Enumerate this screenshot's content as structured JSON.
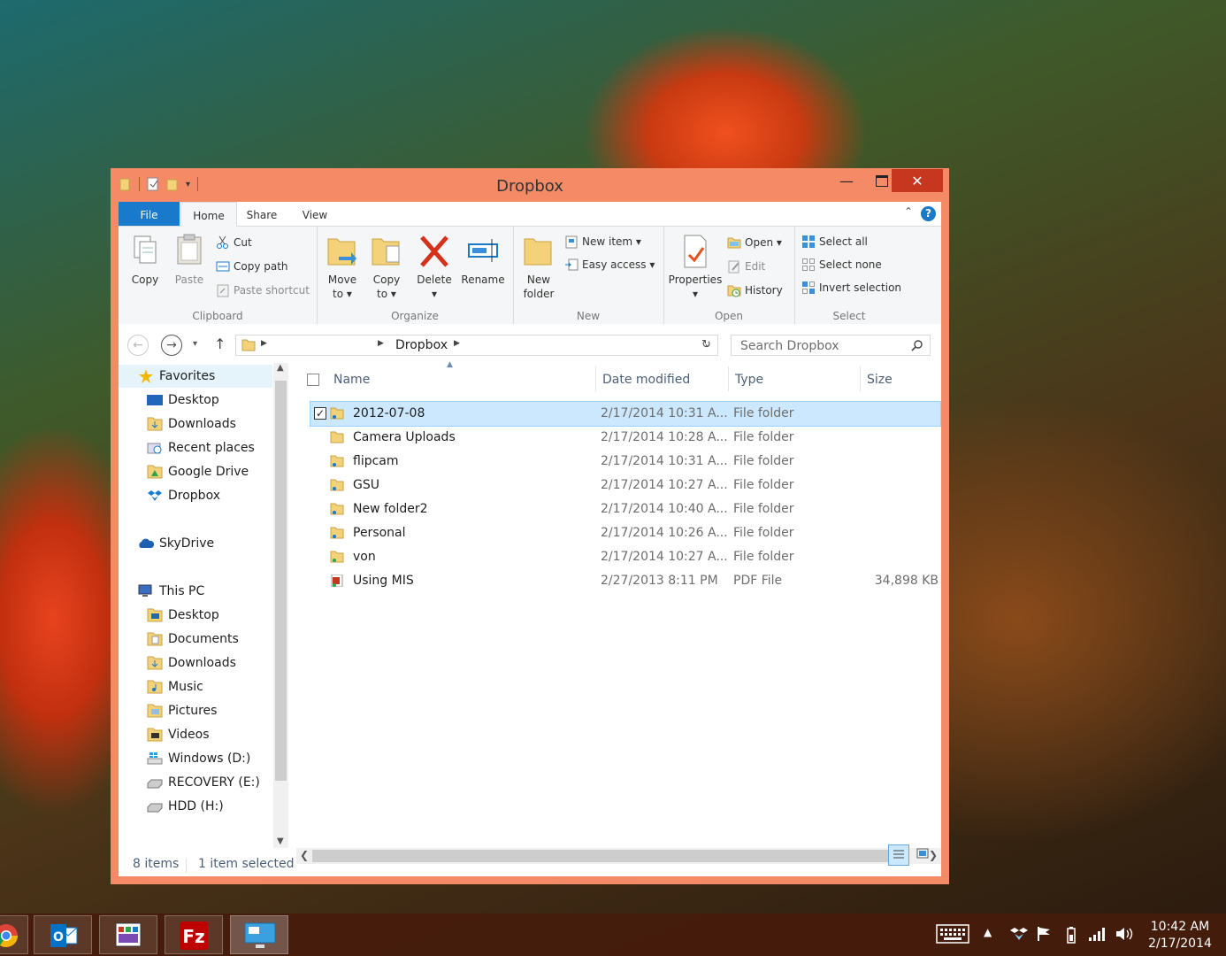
{
  "window": {
    "title": "Dropbox"
  },
  "ribbon": {
    "tabs": [
      "File",
      "Home",
      "Share",
      "View"
    ],
    "help": "?",
    "clipboard": {
      "label": "Clipboard",
      "copy": "Copy",
      "paste": "Paste",
      "cut": "Cut",
      "copy_path": "Copy path",
      "paste_shortcut": "Paste shortcut"
    },
    "organize": {
      "label": "Organize",
      "move_to_1": "Move",
      "move_to_2": "to ▾",
      "copy_to_1": "Copy",
      "copy_to_2": "to ▾",
      "delete_1": "Delete",
      "delete_2": "▾",
      "rename": "Rename"
    },
    "new": {
      "label": "New",
      "new_folder_1": "New",
      "new_folder_2": "folder",
      "new_item": "New item ▾",
      "easy_access": "Easy access ▾"
    },
    "open": {
      "label": "Open",
      "properties_1": "Properties",
      "properties_2": "▾",
      "open": "Open ▾",
      "edit": "Edit",
      "history": "History"
    },
    "select": {
      "label": "Select",
      "select_all": "Select all",
      "select_none": "Select none",
      "invert_selection": "Invert selection"
    }
  },
  "address": {
    "crumb": "Dropbox",
    "search_placeholder": "Search Dropbox"
  },
  "nav": {
    "favorites": "Favorites",
    "fav_items": [
      "Desktop",
      "Downloads",
      "Recent places",
      "Google Drive",
      "Dropbox"
    ],
    "skydrive": "SkyDrive",
    "this_pc": "This PC",
    "pc_items": [
      "Desktop",
      "Documents",
      "Downloads",
      "Music",
      "Pictures",
      "Videos",
      "Windows (D:)",
      "RECOVERY (E:)",
      "HDD (H:)"
    ]
  },
  "columns": {
    "name": "Name",
    "date": "Date modified",
    "type": "Type",
    "size": "Size"
  },
  "files": [
    {
      "name": "2012-07-08",
      "date": "2/17/2014 10:31 A...",
      "type": "File folder",
      "size": "",
      "selected": true
    },
    {
      "name": "Camera Uploads",
      "date": "2/17/2014 10:28 A...",
      "type": "File folder",
      "size": ""
    },
    {
      "name": "flipcam",
      "date": "2/17/2014 10:31 A...",
      "type": "File folder",
      "size": ""
    },
    {
      "name": "GSU",
      "date": "2/17/2014 10:27 A...",
      "type": "File folder",
      "size": ""
    },
    {
      "name": "New folder2",
      "date": "2/17/2014 10:40 A...",
      "type": "File folder",
      "size": ""
    },
    {
      "name": "Personal",
      "date": "2/17/2014 10:26 A...",
      "type": "File folder",
      "size": ""
    },
    {
      "name": "von",
      "date": "2/17/2014 10:27 A...",
      "type": "File folder",
      "size": ""
    },
    {
      "name": "Using MIS",
      "date": "2/27/2013 8:11 PM",
      "type": "PDF File",
      "size": "34,898 KB"
    }
  ],
  "status": {
    "items": "8 items",
    "selected": "1 item selected"
  },
  "taskbar": {
    "time": "10:42 AM",
    "date": "2/17/2014"
  },
  "colors": {
    "window_frame": "#f48a66",
    "close_button": "#c7361f",
    "file_tab": "#1979ca",
    "selection": "#cce8ff"
  }
}
